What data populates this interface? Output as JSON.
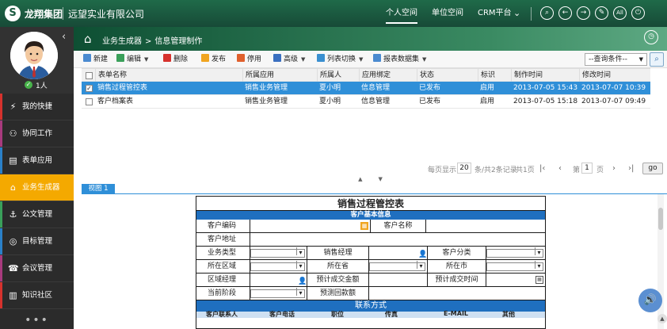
{
  "header": {
    "brand": "龙翔集团",
    "company": "远望实业有限公司",
    "nav": [
      "个人空间",
      "单位空间",
      "CRM平台"
    ],
    "active_nav": "个人空间",
    "icons": [
      "search-icon",
      "back-icon",
      "forward-icon",
      "edit-icon",
      "all-icon",
      "power-icon"
    ],
    "icon_glyphs": [
      "⌕",
      "←",
      "→",
      "✎",
      "All",
      "⏻"
    ]
  },
  "sidebar": {
    "user_count": "1人",
    "items": [
      {
        "label": "我的快捷",
        "icon": "shortcut-icon",
        "glyph": "⚡",
        "stripe": "#d6322d"
      },
      {
        "label": "协同工作",
        "icon": "collab-icon",
        "glyph": "⚇",
        "stripe": "#a83a7d"
      },
      {
        "label": "表单应用",
        "icon": "form-icon",
        "glyph": "▤",
        "stripe": "#2a80c8"
      },
      {
        "label": "业务生成器",
        "icon": "builder-icon",
        "glyph": "⌂",
        "stripe": "#f4a900"
      },
      {
        "label": "公文管理",
        "icon": "document-icon",
        "glyph": "⚓",
        "stripe": "#3aa05a"
      },
      {
        "label": "目标管理",
        "icon": "target-icon",
        "glyph": "◎",
        "stripe": "#2a80c8"
      },
      {
        "label": "会议管理",
        "icon": "meeting-icon",
        "glyph": "☎",
        "stripe": "#a83a7d"
      },
      {
        "label": "知识社区",
        "icon": "knowledge-icon",
        "glyph": "▥",
        "stripe": "#d6322d"
      }
    ],
    "active_index": 3
  },
  "breadcrumb": {
    "items": [
      "业务生成器",
      "信息管理制作"
    ],
    "separator": ">"
  },
  "toolbar": {
    "buttons": [
      {
        "label": "新建",
        "color": "#4a8ad0",
        "has_menu": false
      },
      {
        "label": "编辑",
        "color": "#3aa05a",
        "has_menu": true
      },
      {
        "label": "删除",
        "color": "#d6322d",
        "has_menu": false
      },
      {
        "label": "发布",
        "color": "#f0a520",
        "has_menu": false
      },
      {
        "label": "停用",
        "color": "#e0602d",
        "has_menu": false
      },
      {
        "label": "高级",
        "color": "#3a6fc0",
        "has_menu": true
      },
      {
        "label": "列表切换",
        "color": "#3a8fd0",
        "has_menu": true
      },
      {
        "label": "报表数据集",
        "color": "#4a8ad0",
        "has_menu": true
      }
    ],
    "query_placeholder": "--查询条件--"
  },
  "table": {
    "columns": [
      "表单名称",
      "所属应用",
      "所属人",
      "应用绑定",
      "状态",
      "标识",
      "制作时间",
      "修改时间"
    ],
    "rows": [
      {
        "checked": true,
        "selected": true,
        "cells": [
          "销售过程管控表",
          "销售业务管理",
          "夏小明",
          "信息管理",
          "已发布",
          "启用",
          "2013-07-05 15:43",
          "2013-07-07 10:39"
        ]
      },
      {
        "checked": false,
        "selected": false,
        "cells": [
          "客户档案表",
          "销售业务管理",
          "夏小明",
          "信息管理",
          "已发布",
          "启用",
          "2013-07-05 15:18",
          "2013-07-07 09:49"
        ]
      }
    ]
  },
  "pager": {
    "per_page_label": "每页显示",
    "per_page": "20",
    "summary": "条/共2条记录",
    "total_pages": "共1页",
    "page_prefix": "第",
    "current_page": "1",
    "page_suffix": "页",
    "go": "go"
  },
  "view_tab": "视图 1",
  "form": {
    "title": "销售过程管控表",
    "section1": "客户基本信息",
    "rows": [
      [
        "客户编码",
        "客户名称"
      ],
      [
        "客户地址"
      ],
      [
        "业务类型",
        "销售经理",
        "客户分类"
      ],
      [
        "所在区域",
        "所在省",
        "所在市"
      ],
      [
        "区域经理",
        "预计成交金额",
        "预计成交时间"
      ],
      [
        "当前阶段",
        "预测回款额"
      ]
    ],
    "section2": "联系方式",
    "contact_columns": [
      "客户联系人",
      "客户电话",
      "职位",
      "传真",
      "E-MAIL",
      "其他"
    ]
  }
}
